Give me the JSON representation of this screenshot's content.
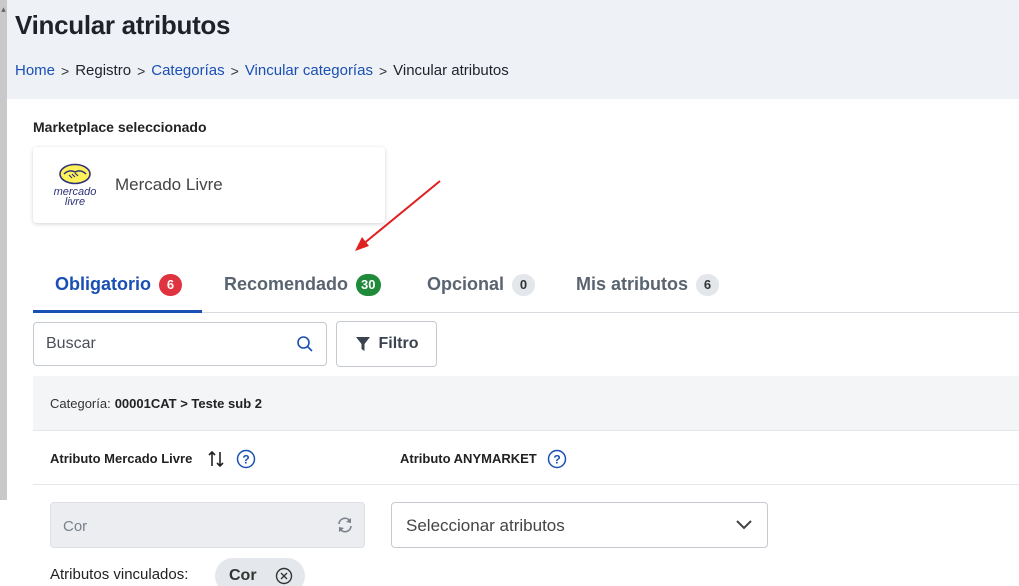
{
  "header": {
    "title": "Vincular atributos",
    "breadcrumb": [
      {
        "label": "Home",
        "link": true
      },
      {
        "label": "Registro",
        "link": false
      },
      {
        "label": "Categorías",
        "link": true
      },
      {
        "label": "Vincular categorías",
        "link": true
      },
      {
        "label": "Vincular atributos",
        "link": false
      }
    ]
  },
  "marketplace": {
    "section_label": "Marketplace seleccionado",
    "logo_text_line1": "mercado",
    "logo_text_line2": "livre",
    "name": "Mercado Livre"
  },
  "tabs": [
    {
      "label": "Obligatorio",
      "count": "6",
      "badge_color": "#e03340",
      "active": true
    },
    {
      "label": "Recomendado",
      "count": "30",
      "badge_color": "#1e8a3a",
      "active": false
    },
    {
      "label": "Opcional",
      "count": "0",
      "badge_color": "#e3e6ea",
      "active": false
    },
    {
      "label": "Mis atributos",
      "count": "6",
      "badge_color": "#e3e6ea",
      "active": false
    }
  ],
  "toolbar": {
    "search_placeholder": "Buscar",
    "filter_label": "Filtro"
  },
  "category": {
    "label": "Categoría:",
    "value": "00001CAT > Teste sub 2"
  },
  "table": {
    "col_marketplace": "Atributo Mercado Livre",
    "col_anymarket": "Atributo ANYMARKET"
  },
  "row": {
    "ml_attribute": "Cor",
    "select_placeholder": "Seleccionar atributos",
    "linked_label": "Atributos vinculados:",
    "linked_chip": "Cor"
  },
  "colors": {
    "accent": "#1a4fb4",
    "annotation_arrow": "#e02020"
  }
}
